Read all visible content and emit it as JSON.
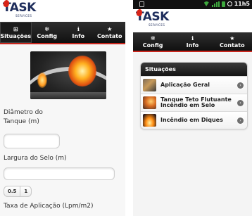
{
  "left_screen": {
    "logo": {
      "word": "TASK",
      "sub": "SERVICES"
    },
    "nav": [
      {
        "label": "Situações",
        "icon": "grid-icon",
        "glyph": "⊞"
      },
      {
        "label": "Config",
        "icon": "gear-icon",
        "glyph": "✻"
      },
      {
        "label": "Info",
        "icon": "info-icon",
        "glyph": "ℹ"
      },
      {
        "label": "Contato",
        "icon": "star-icon",
        "glyph": "★"
      }
    ],
    "form": {
      "diametro_label": "Diâmetro do Tanque (m)",
      "diametro_value": "",
      "largura_label": "Largura do Selo (m)",
      "largura_value": "",
      "segment_options": [
        "0.5",
        "1"
      ],
      "taxa_label": "Taxa de Aplicação (Lpm/m2)"
    }
  },
  "right_screen": {
    "status": {
      "time": "11h5"
    },
    "logo": {
      "word": "TASK",
      "sub": "SERVICES"
    },
    "nav": [
      {
        "label": "Config",
        "icon": "gear-icon",
        "glyph": "✻"
      },
      {
        "label": "Info",
        "icon": "info-icon",
        "glyph": "ℹ"
      },
      {
        "label": "Contato",
        "icon": "star-icon",
        "glyph": "★"
      }
    ],
    "panel": {
      "title": "Situações",
      "items": [
        {
          "label": "Aplicação Geral"
        },
        {
          "label": "Tanque Teto Flutuante Incêndio em Selo"
        },
        {
          "label": "Incêndio em Diques"
        }
      ]
    }
  },
  "colors": {
    "brand_navy": "#1e2d5c",
    "brand_red": "#c9261d",
    "nav_dark": "#1a1a1a"
  }
}
